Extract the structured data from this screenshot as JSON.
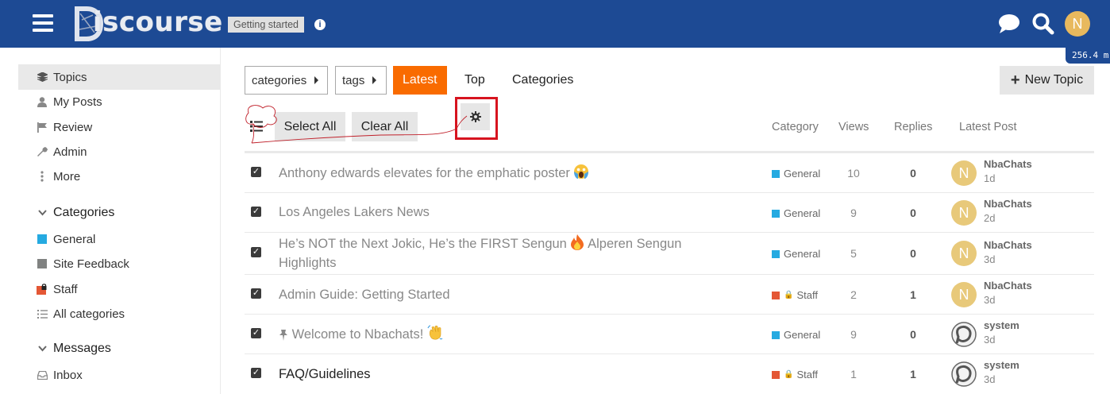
{
  "header": {
    "logo_text": "iscourse",
    "badge": "Getting started",
    "info_glyph": "i",
    "avatar_letter": "N",
    "mem_readout": "256.4 m",
    "bg_color": "#1d4a94"
  },
  "sidebar": {
    "items": [
      {
        "label": "Topics",
        "icon": "layers-icon"
      },
      {
        "label": "My Posts",
        "icon": "user-icon"
      },
      {
        "label": "Review",
        "icon": "flag-icon"
      },
      {
        "label": "Admin",
        "icon": "wrench-icon"
      },
      {
        "label": "More",
        "icon": "ellipsis-vertical-icon"
      }
    ],
    "categories_heading": "Categories",
    "categories": [
      {
        "label": "General",
        "color": "#25aae1"
      },
      {
        "label": "Site Feedback",
        "color": "#808281"
      },
      {
        "label": "Staff",
        "color": "#e45735"
      },
      {
        "label": "All categories",
        "color": ""
      }
    ],
    "messages_heading": "Messages",
    "messages": [
      {
        "label": "Inbox",
        "icon": "inbox-icon"
      }
    ]
  },
  "nav": {
    "categories_drop": "categories",
    "tags_drop": "tags",
    "latest": "Latest",
    "top": "Top",
    "categories": "Categories",
    "new_topic": "New Topic",
    "active_color": "#f96b00"
  },
  "bulk": {
    "select_all": "Select All",
    "clear_all": "Clear All"
  },
  "columns": {
    "category": "Category",
    "views": "Views",
    "replies": "Replies",
    "latest_post": "Latest Post"
  },
  "topics": [
    {
      "title": "Anthony edwards elevates for the emphatic poster",
      "emoji": "scream-emoji",
      "category": "General",
      "cat_color": "#25aae1",
      "locked": false,
      "views": "10",
      "replies": "0",
      "user": "NbaChats",
      "time": "1d",
      "avatar": "N",
      "unread": false
    },
    {
      "title": "Los Angeles Lakers News",
      "emoji": "",
      "category": "General",
      "cat_color": "#25aae1",
      "locked": false,
      "views": "9",
      "replies": "0",
      "user": "NbaChats",
      "time": "2d",
      "avatar": "N",
      "unread": false
    },
    {
      "title_line1": "He’s NOT the Next Jokic, He’s the FIRST Sengun",
      "title_line2": "Alperen Sengun",
      "title_line3": "Highlights",
      "emoji": "fire-emoji",
      "category": "General",
      "cat_color": "#25aae1",
      "locked": false,
      "views": "5",
      "replies": "0",
      "user": "NbaChats",
      "time": "3d",
      "avatar": "N",
      "unread": false
    },
    {
      "title": "Admin Guide: Getting Started",
      "emoji": "",
      "category": "Staff",
      "cat_color": "#e45735",
      "locked": true,
      "views": "2",
      "replies": "1",
      "user": "NbaChats",
      "time": "3d",
      "avatar": "N",
      "unread": false
    },
    {
      "title": "Welcome to Nbachats!",
      "emoji": "wave-emoji",
      "category": "General",
      "cat_color": "#25aae1",
      "locked": false,
      "views": "9",
      "replies": "0",
      "user": "system",
      "time": "3d",
      "avatar": "",
      "unread": false,
      "pinned": true
    },
    {
      "title": "FAQ/Guidelines",
      "emoji": "",
      "category": "Staff",
      "cat_color": "#e45735",
      "locked": true,
      "views": "1",
      "replies": "1",
      "user": "system",
      "time": "3d",
      "avatar": "",
      "unread": true
    }
  ]
}
